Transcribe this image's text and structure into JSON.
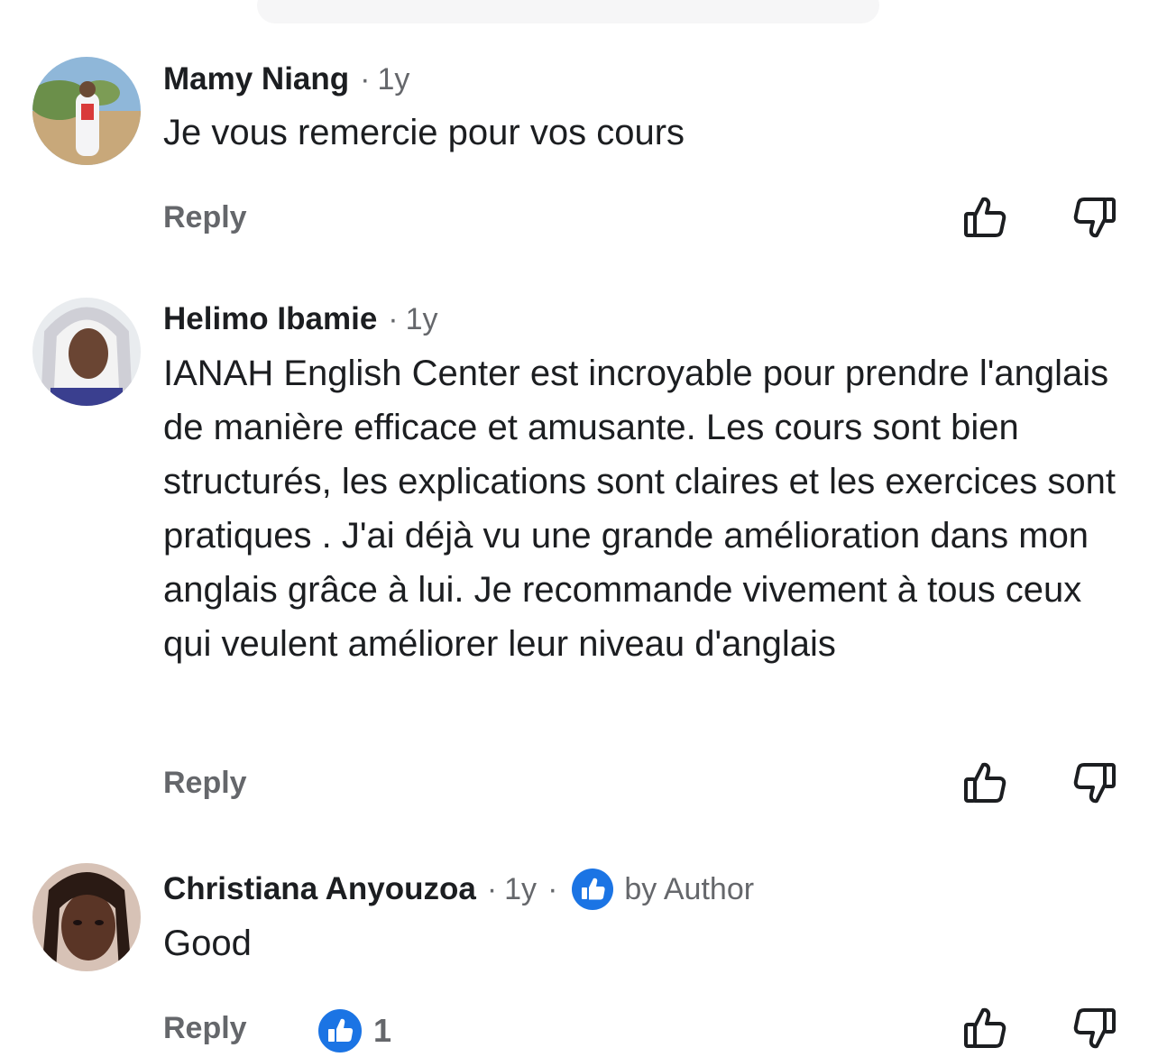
{
  "comments": [
    {
      "author": "Mamy Niang",
      "age": "1y",
      "text": "Je vous remercie pour vos cours",
      "reply_label": "Reply"
    },
    {
      "author": "Helimo Ibamie",
      "age": "1y",
      "text": "IANAH English Center est incroyable pour prendre l'anglais de manière efficace et amusante. Les cours sont bien structurés, les explications sont claires et les exercices sont pratiques . J'ai déjà vu une grande amélioration dans mon anglais grâce à lui.  Je recommande vivement à tous ceux qui veulent améliorer leur niveau d'anglais",
      "reply_label": "Reply"
    },
    {
      "author": "Christiana Anyouzoa",
      "age": "1y",
      "liked_by": "by Author",
      "text": "Good",
      "reply_label": "Reply",
      "reaction_count": "1"
    }
  ],
  "separator": "·",
  "colors": {
    "primary_text": "#1c1e21",
    "secondary_text": "#65676b",
    "accent_blue": "#1b74e4"
  },
  "icons": {
    "upvote": "thumbs-up-outline-icon",
    "downvote": "thumbs-down-outline-icon",
    "reaction": "like-icon"
  }
}
